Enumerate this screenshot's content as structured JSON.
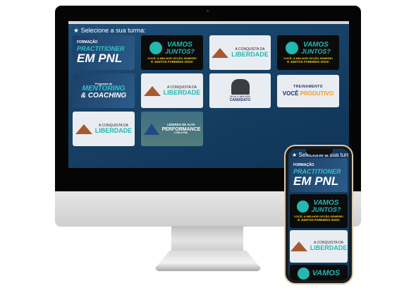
{
  "screen": {
    "header": "Selecione a sua turma:",
    "courses": [
      {
        "line1": "FORMAÇÃO",
        "line2": "PRACTITIONER",
        "line3": "EM PNL"
      },
      {
        "line1": "VAMOS",
        "line2": "JUNTOS?",
        "line3": "VOCÊ: A MELHOR OPÇÃO SEMPRE!",
        "line4": "E JUNTOS FAREMOS ISSO!"
      },
      {
        "line1": "A CONQUISTA DA",
        "line2": "LIBERDADE"
      },
      {
        "line1": "VAMOS",
        "line2": "JUNTOS?",
        "line3": "VOCÊ: A MELHOR OPÇÃO SEMPRE!",
        "line4": "E JUNTOS FAREMOS ISSO!"
      },
      {
        "line1": "Programa de",
        "line2": "MENTORING",
        "line3": "& COACHING"
      },
      {
        "line1": "A CONQUISTA DA",
        "line2": "LIBERDADE"
      },
      {
        "line1": "SEJA O MELHOR",
        "line2": "CANDIDATO"
      },
      {
        "line1": "TREINAMENTO",
        "line2": "VOCÊ",
        "line3": "PRODUTIVO"
      },
      {
        "line1": "A CONQUISTA DA",
        "line2": "LIBERDADE"
      },
      {
        "line1": "LÍDERES DE ALTA",
        "line2": "PERFORMANCE",
        "line3": "COM A PNL"
      }
    ]
  },
  "phone": {
    "header": "Selecione a sua turma:"
  }
}
